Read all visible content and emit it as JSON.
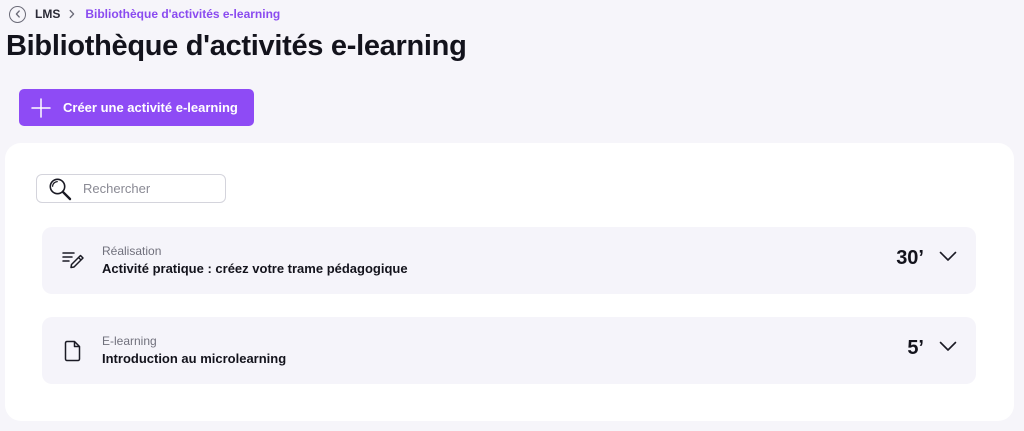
{
  "breadcrumb": {
    "root": "LMS",
    "current": "Bibliothèque d'activités e-learning"
  },
  "page": {
    "title": "Bibliothèque d'activités e-learning"
  },
  "toolbar": {
    "create_label": "Créer une activité e-learning"
  },
  "search": {
    "placeholder": "Rechercher",
    "value": ""
  },
  "activities": [
    {
      "type": "Réalisation",
      "title": "Activité pratique : créez votre trame pédagogique",
      "duration": "30’",
      "icon": "pencil-lines-icon"
    },
    {
      "type": "E-learning",
      "title": "Introduction au microlearning",
      "duration": "5’",
      "icon": "document-icon"
    }
  ],
  "colors": {
    "accent": "#8e4bf5",
    "breadcrumb_current": "#8a4bf0",
    "background": "#f6f5fa",
    "card": "#f5f4fa"
  }
}
